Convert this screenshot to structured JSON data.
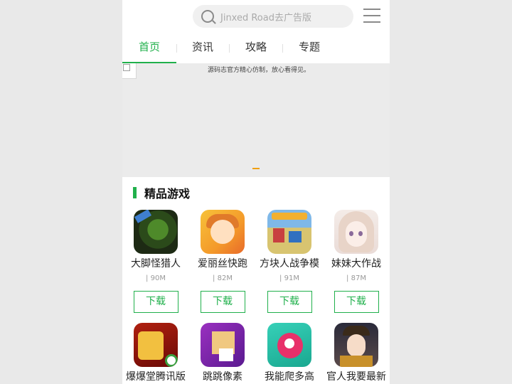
{
  "search": {
    "placeholder": "Jinxed Road去广告版"
  },
  "tabs": [
    {
      "label": "首页",
      "active": true
    },
    {
      "label": "资讯",
      "active": false
    },
    {
      "label": "攻略",
      "active": false
    },
    {
      "label": "专题",
      "active": false
    }
  ],
  "banner": {
    "text": "源码志官方精心仿制，放心看得见。"
  },
  "section": {
    "title": "精品游戏"
  },
  "apps": [
    {
      "name": "大脚怪猎人",
      "size": "| 90M",
      "button": "下载",
      "icon": "bigfoot-game-icon"
    },
    {
      "name": "爱丽丝快跑",
      "size": "| 82M",
      "button": "下载",
      "icon": "alice-game-icon"
    },
    {
      "name": "方块人战争模",
      "size": "| 91M",
      "button": "下载",
      "icon": "block-war-game-icon"
    },
    {
      "name": "妹妹大作战",
      "size": "| 87M",
      "button": "下载",
      "icon": "anime-girl-game-icon"
    },
    {
      "name": "爆爆堂腾讯版",
      "icon": "baobaotang-game-icon"
    },
    {
      "name": "跳跳像素",
      "icon": "pixel-jump-game-icon"
    },
    {
      "name": "我能爬多高",
      "icon": "climb-game-icon"
    },
    {
      "name": "官人我要最新",
      "icon": "qing-official-game-icon"
    }
  ],
  "colors": {
    "accent": "#20b04b",
    "indicator": "#f0a010"
  }
}
